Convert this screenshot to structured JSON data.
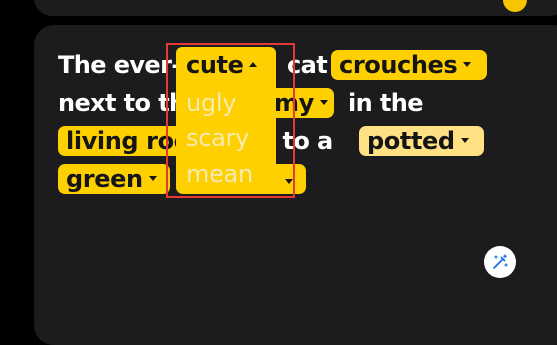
{
  "sentence": {
    "w1": "The ever-",
    "w2": "cat",
    "w3": "next to th",
    "w4": "in the",
    "w5": "xt to a"
  },
  "pills": {
    "cute": "cute",
    "crouches": "crouches",
    "my": "my",
    "living_room": "living roo",
    "potted": "potted",
    "green": "green"
  },
  "dropdown": {
    "options": [
      "ugly",
      "scary",
      "mean"
    ]
  },
  "colors": {
    "accent": "#ffd000",
    "accent_light": "#ffe082",
    "card": "#1c1c1e",
    "highlight_box": "#e53935"
  },
  "icons": {
    "edit": "magic-wand-edit-icon"
  }
}
